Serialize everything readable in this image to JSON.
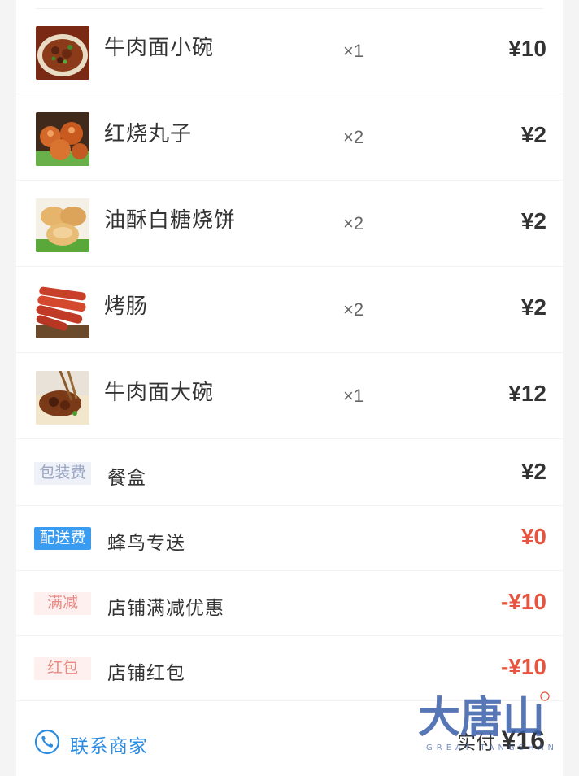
{
  "items": [
    {
      "name": "牛肉面小碗",
      "qty": "×1",
      "price": "¥10",
      "icon": "beef-noodle-small-icon"
    },
    {
      "name": "红烧丸子",
      "qty": "×2",
      "price": "¥2",
      "icon": "braised-meatballs-icon"
    },
    {
      "name": "油酥白糖烧饼",
      "qty": "×2",
      "price": "¥2",
      "icon": "sugar-pastry-icon"
    },
    {
      "name": "烤肠",
      "qty": "×2",
      "price": "¥2",
      "icon": "sausage-icon"
    },
    {
      "name": "牛肉面大碗",
      "qty": "×1",
      "price": "¥12",
      "icon": "beef-noodle-large-icon"
    }
  ],
  "fees": [
    {
      "tag": "包装费",
      "name": "餐盒",
      "amount": "¥2"
    },
    {
      "tag": "配送费",
      "name": "蜂鸟专送",
      "amount": "¥0"
    },
    {
      "tag": "满减",
      "name": "店铺满减优惠",
      "amount": "-¥10"
    },
    {
      "tag": "红包",
      "name": "店铺红包",
      "amount": "-¥10"
    }
  ],
  "footer": {
    "contact_label": "联系商家",
    "paid_label": "实付",
    "paid_value": "¥16"
  },
  "watermark": {
    "text": "大唐山",
    "sub": "GREAT TANGSHAN"
  },
  "colors": {
    "accent_blue": "#2a8be0",
    "delivery_tag": "#3a9cf0",
    "discount_red": "#e8543f",
    "text_dark": "#333333"
  }
}
